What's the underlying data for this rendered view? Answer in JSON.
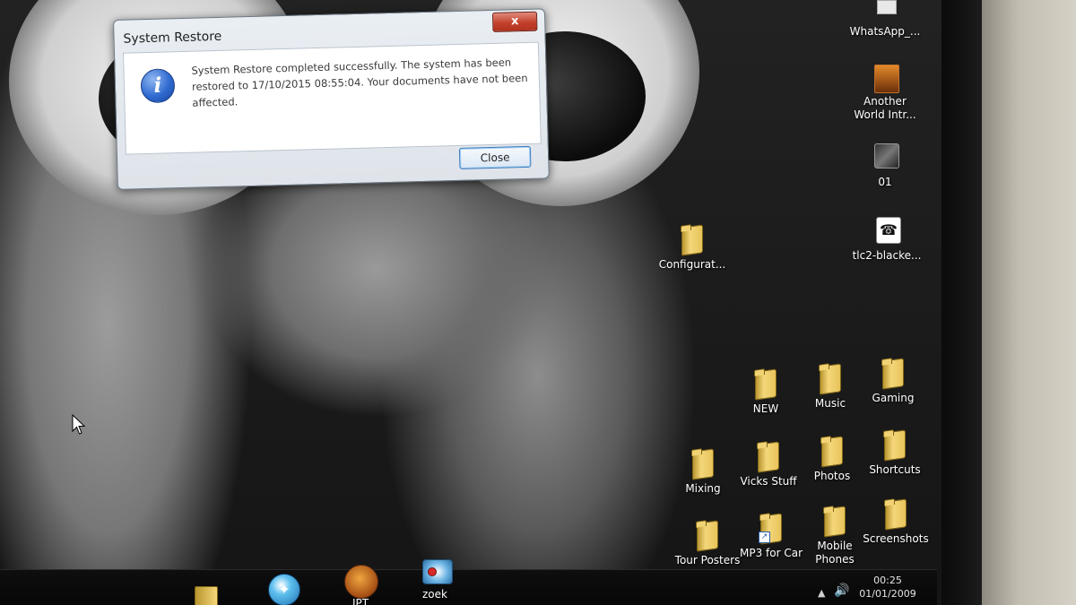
{
  "dialog": {
    "title": "System Restore",
    "close_glyph": "x",
    "message": "System Restore completed successfully. The system has been restored to 17/10/2015 08:55:04. Your documents have not been affected.",
    "close_button_label": "Close",
    "info_glyph": "i"
  },
  "desktop": {
    "icons": {
      "whatsapp": "WhatsApp_...",
      "another_world": "Another World Intr...",
      "file_01": "01",
      "tlc2": "tlc2-blacke...",
      "configurat": "Configurat...",
      "new": "NEW",
      "music": "Music",
      "gaming": "Gaming",
      "mixing": "Mixing",
      "vicks_stuff": "Vicks Stuff",
      "photos": "Photos",
      "shortcuts": "Shortcuts",
      "tour_posters": "Tour Posters",
      "mp3_for_car": "MP3 for Car",
      "mobile_phones": "Mobile Phones",
      "screenshots": "Screenshots"
    }
  },
  "taskbar": {
    "items": {
      "ipt": "IPT",
      "zoek": "zoek"
    },
    "tray": {
      "time": "00:25",
      "date": "01/01/2009"
    }
  },
  "colors": {
    "folder": "#e7c35a",
    "close_x": "#c3412c",
    "info_blue": "#2f6ad0",
    "focus_border": "#3d7bbd"
  }
}
